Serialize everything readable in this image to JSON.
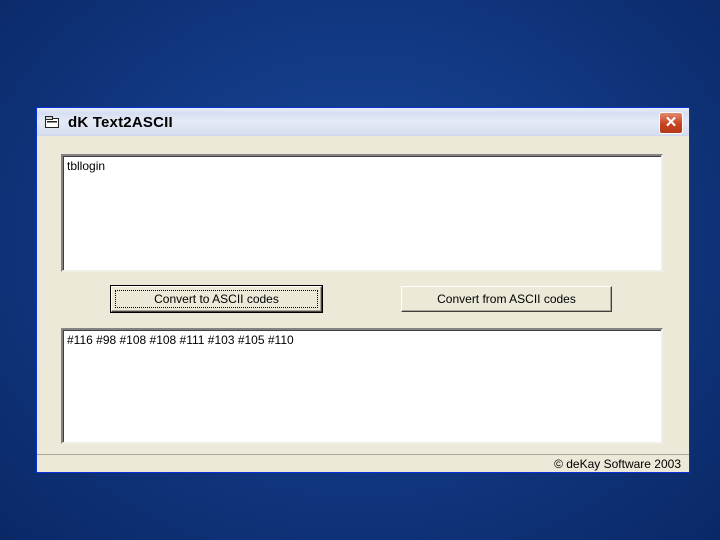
{
  "window": {
    "title": "dK Text2ASCII",
    "close_label": "✕"
  },
  "input": {
    "value": "tbllogin"
  },
  "buttons": {
    "to_ascii": "Convert to ASCII codes",
    "from_ascii": "Convert from ASCII codes"
  },
  "output": {
    "value": "#116 #98 #108 #108 #111 #103 #105 #110"
  },
  "status": {
    "copyright": "© deKay Software 2003"
  },
  "colors": {
    "desktop": "#123a85",
    "window_bg": "#ece9d8",
    "close_button": "#c9411f"
  }
}
